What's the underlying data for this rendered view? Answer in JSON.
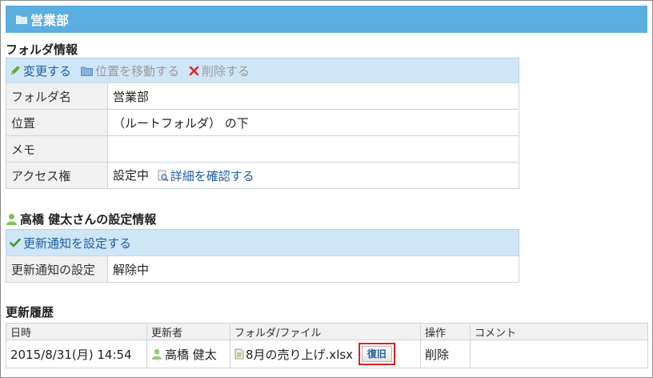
{
  "page": {
    "title": "営業部"
  },
  "folder_info": {
    "heading": "フォルダ情報",
    "actions": {
      "edit": "変更する",
      "move": "位置を移動する",
      "delete": "削除する"
    },
    "rows": [
      {
        "label": "フォルダ名",
        "value": "営業部"
      },
      {
        "label": "位置",
        "value": "（ルートフォルダ） の下"
      },
      {
        "label": "メモ",
        "value": ""
      },
      {
        "label": "アクセス権",
        "value": "設定中",
        "link": "詳細を確認する"
      }
    ]
  },
  "user_settings": {
    "heading": "高橋 健太さんの設定情報",
    "action": "更新通知を設定する",
    "rows": [
      {
        "label": "更新通知の設定",
        "value": "解除中"
      }
    ]
  },
  "history": {
    "heading": "更新履歴",
    "columns": [
      "日時",
      "更新者",
      "フォルダ/ファイル",
      "操作",
      "コメント"
    ],
    "rows": [
      {
        "datetime": "2015/8/31(月) 14:54",
        "user": "高橋 健太",
        "file": "8月の売り上げ.xlsx",
        "restore": "復旧",
        "operation": "削除",
        "comment": ""
      }
    ]
  },
  "colors": {
    "title_bar": "#5aaee0",
    "toolbar_bg": "#cfe6f6",
    "link": "#1d5fa8",
    "highlight": "#e02020"
  }
}
